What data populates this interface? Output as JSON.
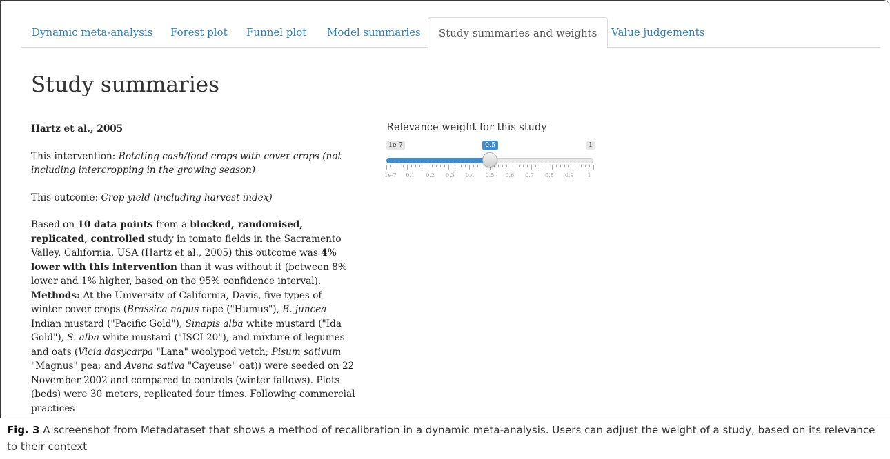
{
  "tabs": [
    {
      "label": "Dynamic meta-analysis",
      "active": false
    },
    {
      "label": "Forest plot",
      "active": false
    },
    {
      "label": "Funnel plot",
      "active": false
    },
    {
      "label": "Model summaries",
      "active": false
    },
    {
      "label": "Study summaries and weights",
      "active": true
    },
    {
      "label": "Value judgements",
      "active": false
    }
  ],
  "heading": "Study summaries",
  "study": {
    "name": "Hartz et al., 2005",
    "intervention_prefix": "This intervention: ",
    "intervention": "Rotating cash/food crops with cover crops (not including intercropping in the growing season)",
    "outcome_prefix": "This outcome: ",
    "outcome": "Crop yield (including harvest index)",
    "summary": [
      {
        "t": "Based on ",
        "s": "n"
      },
      {
        "t": "10 data points",
        "s": "b"
      },
      {
        "t": " from a ",
        "s": "n"
      },
      {
        "t": "blocked, randomised, replicated, controlled",
        "s": "b"
      },
      {
        "t": " study in tomato fields in the Sacramento Valley, California, USA (Hartz et al., 2005) this outcome was ",
        "s": "n"
      },
      {
        "t": "4% lower with this intervention",
        "s": "b"
      },
      {
        "t": " than it was without it (between 8% lower and 1% higher, based on the 95% confidence interval). ",
        "s": "n"
      },
      {
        "t": "Methods:",
        "s": "b"
      },
      {
        "t": " At the University of California, Davis, five types of winter cover crops (",
        "s": "n"
      },
      {
        "t": "Brassica napus",
        "s": "i"
      },
      {
        "t": " rape (\"Humus\"), ",
        "s": "n"
      },
      {
        "t": "B. juncea",
        "s": "i"
      },
      {
        "t": " Indian mustard (\"Pacific Gold\"), ",
        "s": "n"
      },
      {
        "t": "Sinapis alba",
        "s": "i"
      },
      {
        "t": " white mustard (\"Ida Gold\"), ",
        "s": "n"
      },
      {
        "t": "S. alba",
        "s": "i"
      },
      {
        "t": " white mustard (\"ISCI 20\"), and mixture of legumes and oats (",
        "s": "n"
      },
      {
        "t": "Vicia dasycarpa",
        "s": "i"
      },
      {
        "t": " \"Lana\" woolypod vetch; ",
        "s": "n"
      },
      {
        "t": "Pisum sativum",
        "s": "i"
      },
      {
        "t": " \"Magnus\" pea; and ",
        "s": "n"
      },
      {
        "t": "Avena sativa",
        "s": "i"
      },
      {
        "t": " \"Cayeuse\" oat)) were seeded on 22 November 2002 and compared to controls (winter fallows). Plots (beds) were 30 meters, replicated four times. Following commercial practices",
        "s": "n"
      }
    ]
  },
  "slider": {
    "label": "Relevance weight for this study",
    "min_label": "1e-7",
    "max_label": "1",
    "value_label": "0.5",
    "value": 0.5,
    "tick_labels": [
      "1e-7",
      "0.1",
      "0.2",
      "0.3",
      "0.4",
      "0.5",
      "0.6",
      "0.7",
      "0.8",
      "0.9",
      "1"
    ],
    "accent_color": "#428bca"
  },
  "caption": {
    "fig_label": "Fig. 3",
    "text": " A screenshot from Metadataset that shows a method of recalibration in a dynamic meta-analysis. Users can adjust the weight of a study, based on its relevance to their context"
  }
}
